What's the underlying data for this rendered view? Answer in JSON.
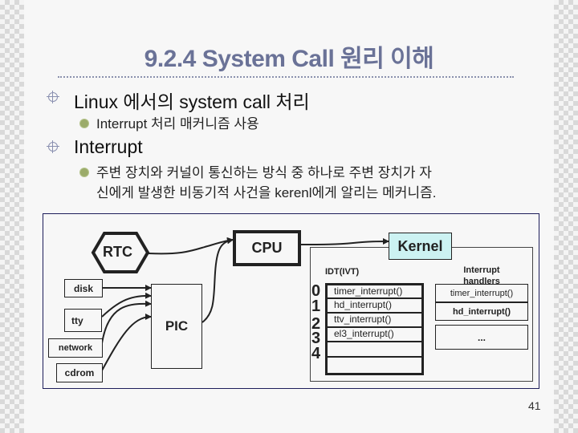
{
  "slide": {
    "title": "9.2.4 System Call 원리 이해",
    "page_number": "41",
    "bullets": [
      {
        "level": 1,
        "icon": "crosshair-circle-icon",
        "text": "Linux 에서의 system call 처리",
        "children": [
          {
            "level": 2,
            "icon": "green-sun-bullet-icon",
            "text": "Interrupt 처리 매커니즘 사용"
          }
        ]
      },
      {
        "level": 1,
        "icon": "crosshair-circle-icon",
        "text": "Interrupt",
        "children": [
          {
            "level": 2,
            "icon": "green-sun-bullet-icon",
            "lines": [
              "주변 장치와 커널이 통신하는 방식 중 하나로 주변 장치가 자",
              "신에게 발생한 비동기적 사건을 kerenl에게 알리는 메커니즘."
            ]
          }
        ]
      }
    ]
  },
  "diagram": {
    "rtc": "RTC",
    "cpu": "CPU",
    "kernel": "Kernel",
    "pic": "PIC",
    "devices": [
      "disk",
      "tty",
      "network",
      "cdrom"
    ],
    "idt_label": "IDT(IVT)",
    "idt_indices": [
      "0",
      "1",
      "2",
      "3",
      "4"
    ],
    "idt_entries": [
      "timer_interrupt()",
      "hd_interrupt()",
      "ttv_interrupt()",
      "el3_interrupt()",
      "",
      ""
    ],
    "handlers_label_line1": "Interrupt",
    "handlers_label_line2": "handlers",
    "handlers": [
      "timer_interrupt()",
      "hd_interrupt()",
      "..."
    ],
    "colors": {
      "title": "#6a7297",
      "kernel_fill": "#ccf2f2",
      "frame_border": "#1d1d5a",
      "bullet_green": "#9bab6a"
    }
  }
}
